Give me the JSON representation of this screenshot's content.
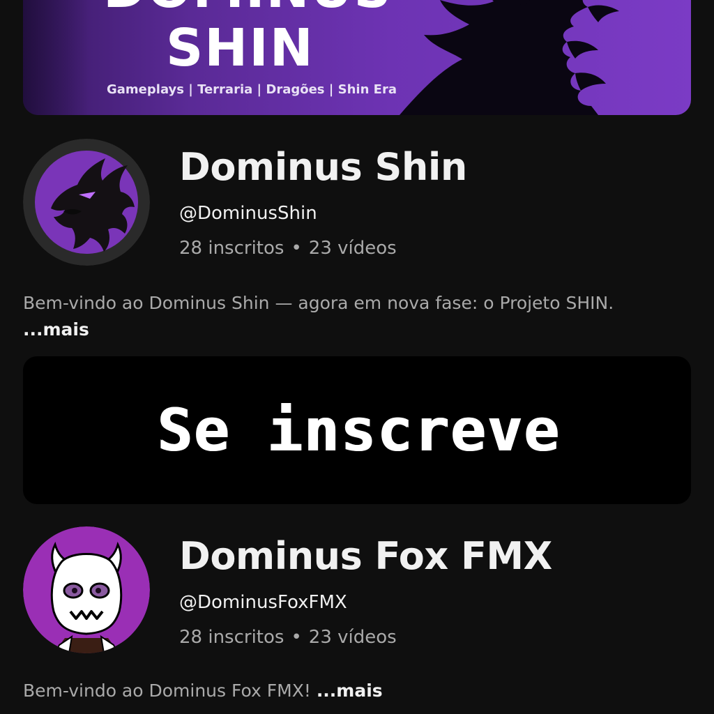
{
  "banner": {
    "title_line1": "DOMINUS",
    "title_line2": "SHIN",
    "subtitle": "Gameplays | Terraria | Dragões | Shin Era",
    "colors": {
      "dark": "#3a1a66",
      "light": "#7b3bc5"
    }
  },
  "channels": [
    {
      "name": "Dominus Shin",
      "handle": "@DominusShin",
      "subscribers": "28 inscritos",
      "separator": "•",
      "videos": "23 vídeos",
      "description": "Bem-vindo ao Dominus Shin — agora em nova fase: o Projeto SHIN.",
      "more_label": "...mais",
      "avatar_icon": "black-dragon-avatar"
    },
    {
      "name": "Dominus Fox FMX",
      "handle": "@DominusFoxFMX",
      "subscribers": "28 inscritos",
      "separator": "•",
      "videos": "23 vídeos",
      "description": "Bem-vindo ao Dominus Fox FMX!",
      "more_label": "...mais",
      "avatar_icon": "horned-mask-avatar"
    }
  ],
  "promo": {
    "text": "Se inscreve"
  },
  "colors": {
    "background": "#0f0f0f",
    "primary_text": "#f1f1f1",
    "secondary_text": "#aaaaaa",
    "accent_purple": "#7b3bc5",
    "avatar_purple": "#9a2fb5"
  }
}
